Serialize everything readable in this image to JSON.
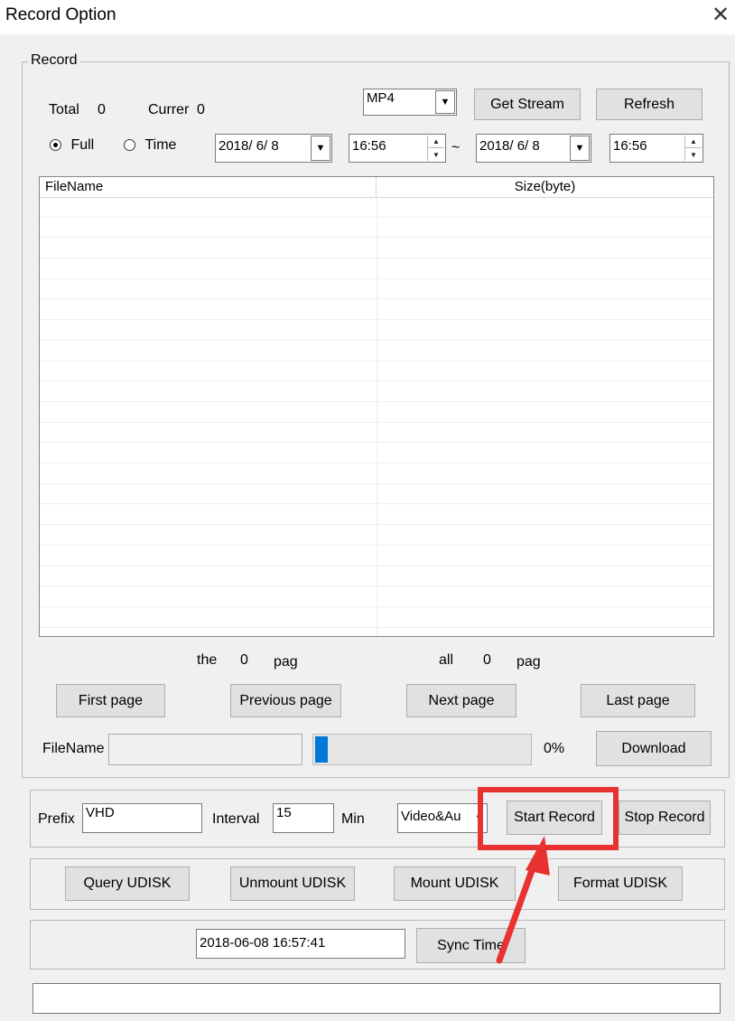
{
  "window": {
    "title": "Record Option",
    "close_glyph": "✕"
  },
  "record_group": {
    "legend": "Record",
    "total_label": "Total",
    "total_value": "0",
    "current_label": "Currer",
    "current_value": "0",
    "format_select": "MP4",
    "get_stream": "Get Stream",
    "refresh": "Refresh",
    "radio_full": "Full",
    "radio_time": "Time",
    "selected_mode": "Full",
    "start_date": "2018/ 6/ 8",
    "start_time": "16:56",
    "range_sep": "~",
    "end_date": "2018/ 6/ 8",
    "end_time": "16:56"
  },
  "file_list": {
    "columns": [
      "FileName",
      "Size(byte)"
    ],
    "rows": []
  },
  "pagination": {
    "the_label": "the",
    "current_page": "0",
    "pag_label_1": "pag",
    "all_label": "all",
    "total_pages": "0",
    "pag_label_2": "pag",
    "first": "First page",
    "previous": "Previous page",
    "next": "Next page",
    "last": "Last page"
  },
  "download": {
    "filename_label": "FileName",
    "filename_value": "",
    "progress_percent": 0,
    "progress_text": "0%",
    "download_button": "Download"
  },
  "recording": {
    "prefix_label": "Prefix",
    "prefix_value": "VHD",
    "interval_label": "Interval",
    "interval_value": "15",
    "interval_unit": "Min",
    "stream_type": "Video&Au",
    "start_record": "Start Record",
    "stop_record": "Stop Record"
  },
  "udisk": {
    "query": "Query UDISK",
    "unmount": "Unmount UDISK",
    "mount": "Mount UDISK",
    "format": "Format UDISK"
  },
  "sync": {
    "datetime_value": "2018-06-08 16:57:41",
    "sync_button": "Sync Time"
  },
  "status_bar": {
    "text": ""
  },
  "annotation": {
    "highlight_color": "#e83232",
    "arrow_color": "#e83232"
  },
  "icons": {
    "dropdown": "chevron-down-icon",
    "spin_up": "spin-up-icon",
    "spin_down": "spin-down-icon"
  }
}
